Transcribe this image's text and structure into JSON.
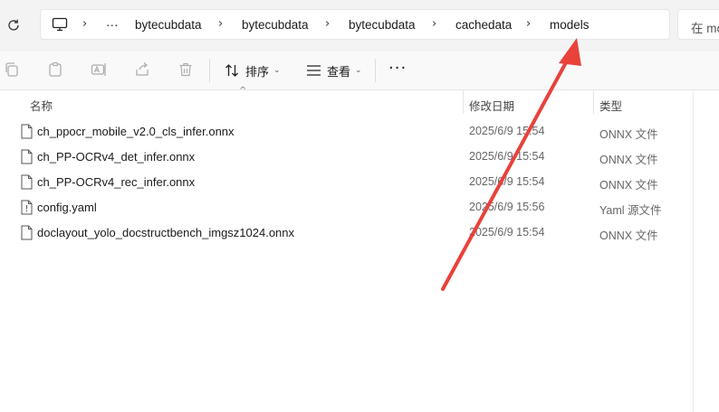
{
  "address_bar": {
    "more_label": "···",
    "segments": [
      "bytecubdata",
      "bytecubdata",
      "bytecubdata",
      "cachedata",
      "models"
    ]
  },
  "search": {
    "placeholder": "在 models"
  },
  "toolbar": {
    "sort_label": "排序",
    "view_label": "查看",
    "more_label": "···"
  },
  "columns": {
    "name": "名称",
    "modified": "修改日期",
    "type": "类型"
  },
  "files": [
    {
      "name": "ch_ppocr_mobile_v2.0_cls_infer.onnx",
      "modified": "2025/6/9 15:54",
      "type": "ONNX 文件",
      "icon": "generic-file-icon"
    },
    {
      "name": "ch_PP-OCRv4_det_infer.onnx",
      "modified": "2025/6/9 15:54",
      "type": "ONNX 文件",
      "icon": "generic-file-icon"
    },
    {
      "name": "ch_PP-OCRv4_rec_infer.onnx",
      "modified": "2025/6/9 15:54",
      "type": "ONNX 文件",
      "icon": "generic-file-icon"
    },
    {
      "name": "config.yaml",
      "modified": "2025/6/9 15:56",
      "type": "Yaml 源文件",
      "icon": "yaml-file-icon"
    },
    {
      "name": "doclayout_yolo_docstructbench_imgsz1024.onnx",
      "modified": "2025/6/9 15:54",
      "type": "ONNX 文件",
      "icon": "generic-file-icon"
    }
  ],
  "annotation": {
    "color": "#e8423b"
  }
}
